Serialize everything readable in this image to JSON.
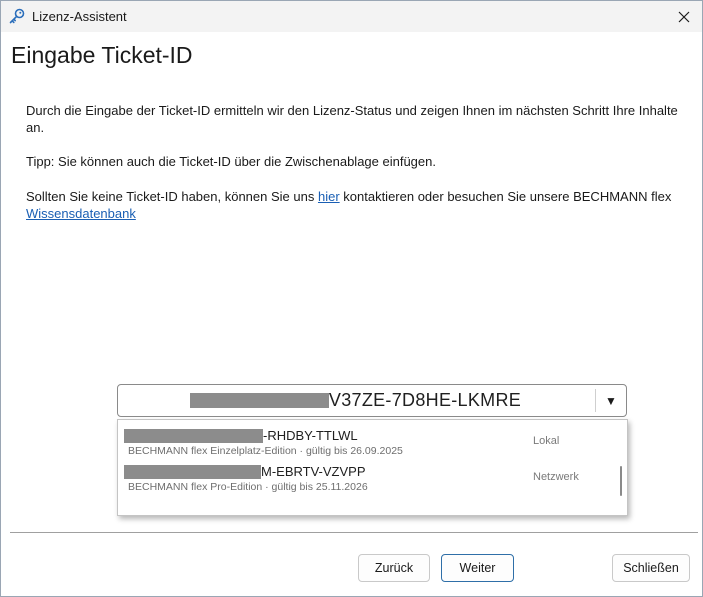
{
  "window": {
    "title": "Lizenz-Assistent"
  },
  "page": {
    "heading": "Eingabe Ticket-ID",
    "intro": "Durch die Eingabe der Ticket-ID ermitteln wir den Lizenz-Status und zeigen Ihnen im nächsten Schritt Ihre Inhalte an.",
    "tip": "Tipp: Sie können auch die Ticket-ID über die Zwischenablage einfügen.",
    "contact_before": "Sollten Sie keine Ticket-ID haben, können Sie uns ",
    "contact_link": "hier",
    "contact_middle": " kontaktieren oder besuchen Sie unsere BECHMANN flex ",
    "knowledge_link": "Wissensdatenbank"
  },
  "combo": {
    "value_suffix": "V37ZE-7D8HE-LKMRE",
    "arrow_glyph": "▼"
  },
  "dropdown": {
    "items": [
      {
        "id_suffix": "-RHDBY-TTLWL",
        "subtitle": "BECHMANN flex Einzelplatz-Edition · gültig bis 26.09.2025",
        "tag": "Lokal"
      },
      {
        "id_suffix": "M-EBRTV-VZVPP",
        "subtitle": "BECHMANN flex Pro-Edition · gültig bis 25.11.2026",
        "tag": "Netzwerk"
      }
    ]
  },
  "buttons": {
    "back": "Zurück",
    "next": "Weiter",
    "close": "Schließen"
  },
  "colors": {
    "link": "#1a5fb4",
    "primary_border": "#2f6fa8",
    "redaction": "#8c8c8c"
  }
}
